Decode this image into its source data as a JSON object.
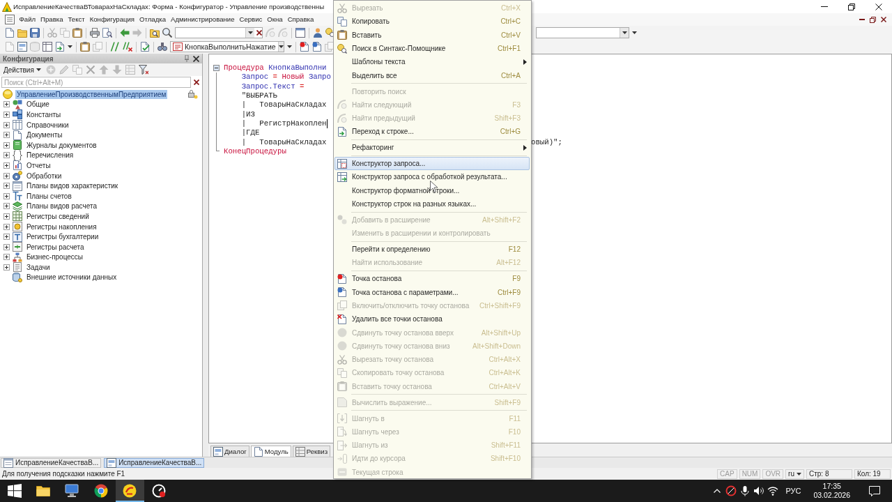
{
  "window": {
    "title": "ИсправлениеКачестваВТоварахНаСкладах: Форма - Конфигуратор - Управление производственны"
  },
  "menu_bar": [
    "Файл",
    "Правка",
    "Текст",
    "Конфигурация",
    "Отладка",
    "Администрирование",
    "Сервис",
    "Окна",
    "Справка"
  ],
  "toolbar": {
    "procedure_selector": "КнопкаВыполнитьНажатие"
  },
  "config_panel": {
    "title": "Конфигурация",
    "actions": "Действия",
    "search": {
      "placeholder": "Поиск (Ctrl+Alt+M)"
    },
    "tree": [
      {
        "label": "УправлениеПроизводственнымПредприятием",
        "kind": "root",
        "selected": true,
        "children": [
          {
            "label": "Общие",
            "kind": "group",
            "expanded": false,
            "selected": false
          },
          {
            "label": "Константы",
            "kind": "group",
            "expanded": false,
            "selected": false
          },
          {
            "label": "Справочники",
            "kind": "group",
            "expanded": false,
            "selected": false
          },
          {
            "label": "Документы",
            "kind": "group",
            "expanded": false,
            "selected": false
          },
          {
            "label": "Журналы документов",
            "kind": "group",
            "expanded": false,
            "selected": false
          },
          {
            "label": "Перечисления",
            "kind": "group",
            "expanded": false,
            "selected": false
          },
          {
            "label": "Отчеты",
            "kind": "group",
            "expanded": false,
            "selected": false
          },
          {
            "label": "Обработки",
            "kind": "group",
            "expanded": false,
            "selected": false
          },
          {
            "label": "Планы видов характеристик",
            "kind": "group",
            "expanded": false,
            "selected": false
          },
          {
            "label": "Планы счетов",
            "kind": "group",
            "expanded": false,
            "selected": false
          },
          {
            "label": "Планы видов расчета",
            "kind": "group",
            "expanded": false,
            "selected": false
          },
          {
            "label": "Регистры сведений",
            "kind": "group",
            "expanded": false,
            "selected": false
          },
          {
            "label": "Регистры накопления",
            "kind": "group",
            "expanded": false,
            "selected": false
          },
          {
            "label": "Регистры бухгалтерии",
            "kind": "group",
            "expanded": false,
            "selected": false
          },
          {
            "label": "Регистры расчета",
            "kind": "group",
            "expanded": false,
            "selected": false
          },
          {
            "label": "Бизнес-процессы",
            "kind": "group",
            "expanded": false,
            "selected": false
          },
          {
            "label": "Задачи",
            "kind": "group",
            "expanded": false,
            "selected": false
          },
          {
            "label": "Внешние источники данных",
            "kind": "leaf",
            "selected": false
          }
        ]
      }
    ]
  },
  "editor": {
    "code": {
      "expanded": true,
      "lines": [
        {
          "tokens": [
            {
              "text": "Процедура ",
              "kind": "keyword"
            },
            {
              "text": "КнопкаВыполни",
              "kind": "identifier"
            }
          ],
          "caret": false
        },
        {
          "tokens": [
            {
              "text": "    Запрос ",
              "kind": "identifier"
            },
            {
              "text": "= ",
              "kind": "operator"
            },
            {
              "text": "Новый ",
              "kind": "keyword"
            },
            {
              "text": "Запро",
              "kind": "identifier"
            }
          ],
          "caret": false
        },
        {
          "tokens": [
            {
              "text": "    Запрос.Текст ",
              "kind": "identifier"
            },
            {
              "text": "=",
              "kind": "operator"
            }
          ],
          "caret": false
        },
        {
          "tokens": [
            {
              "text": "    \"ВЫБРАТЬ",
              "kind": "string"
            }
          ],
          "caret": false
        },
        {
          "tokens": [
            {
              "text": "    |   ТоварыНаСкладах",
              "kind": "string"
            }
          ],
          "caret": false
        },
        {
          "tokens": [
            {
              "text": "    |ИЗ",
              "kind": "string"
            }
          ],
          "caret": false
        },
        {
          "tokens": [
            {
              "text": "    |   РегистрНакоплен",
              "kind": "string"
            }
          ],
          "caret": true
        },
        {
          "tokens": [
            {
              "text": "    |ГДЕ",
              "kind": "string"
            }
          ],
          "caret": false
        },
        {
          "tokens": [
            {
              "text": "    |   ТоварыНаСкладах",
              "kind": "string"
            }
          ],
          "tail": [
            {
              "text": "овый)\";",
              "kind": "string"
            }
          ],
          "caret": false
        },
        {
          "tokens": [
            {
              "text": "КонецПроцедуры",
              "kind": "keyword"
            }
          ],
          "caret": false
        }
      ]
    },
    "tabs": [
      {
        "label": "Диалог",
        "selected": false
      },
      {
        "label": "Модуль",
        "selected": true
      },
      {
        "label": "Реквиз",
        "selected": false
      }
    ]
  },
  "context_menu": {
    "groups": [
      [
        {
          "label": "Вырезать",
          "shortcut": "Ctrl+X",
          "disabled": true,
          "selected": false,
          "submenu": false
        },
        {
          "label": "Копировать",
          "shortcut": "Ctrl+C",
          "disabled": false,
          "selected": false,
          "submenu": false
        },
        {
          "label": "Вставить",
          "shortcut": "Ctrl+V",
          "disabled": false,
          "selected": false,
          "submenu": false
        },
        {
          "label": "Поиск в Синтакс-Помощнике",
          "shortcut": "Ctrl+F1",
          "disabled": false,
          "selected": false,
          "submenu": false
        },
        {
          "label": "Шаблоны текста",
          "disabled": false,
          "selected": false,
          "submenu": true
        },
        {
          "label": "Выделить все",
          "shortcut": "Ctrl+A",
          "disabled": false,
          "selected": false,
          "submenu": false
        }
      ],
      [
        {
          "label": "Повторить поиск",
          "disabled": true,
          "selected": false,
          "submenu": false
        },
        {
          "label": "Найти следующий",
          "shortcut": "F3",
          "disabled": true,
          "selected": false,
          "submenu": false
        },
        {
          "label": "Найти предыдущий",
          "shortcut": "Shift+F3",
          "disabled": true,
          "selected": false,
          "submenu": false
        },
        {
          "label": "Переход к строке...",
          "shortcut": "Ctrl+G",
          "disabled": false,
          "selected": false,
          "submenu": false
        }
      ],
      [
        {
          "label": "Рефакторинг",
          "disabled": false,
          "selected": false,
          "submenu": true
        }
      ],
      [
        {
          "label": "Конструктор запроса...",
          "disabled": false,
          "selected": true,
          "submenu": false
        },
        {
          "label": "Конструктор запроса с обработкой результата...",
          "disabled": false,
          "selected": false,
          "submenu": false
        },
        {
          "label": "Конструктор форматной строки...",
          "disabled": false,
          "selected": false,
          "submenu": false
        },
        {
          "label": "Конструктор строк на разных языках...",
          "disabled": false,
          "selected": false,
          "submenu": false
        }
      ],
      [
        {
          "label": "Добавить в расширение",
          "shortcut": "Alt+Shift+F2",
          "disabled": true,
          "selected": false,
          "submenu": false
        },
        {
          "label": "Изменить в расширении и контролировать",
          "disabled": true,
          "selected": false,
          "submenu": false
        }
      ],
      [
        {
          "label": "Перейти к определению",
          "shortcut": "F12",
          "disabled": false,
          "selected": false,
          "submenu": false
        },
        {
          "label": "Найти использование",
          "shortcut": "Alt+F12",
          "disabled": true,
          "selected": false,
          "submenu": false
        }
      ],
      [
        {
          "label": "Точка останова",
          "shortcut": "F9",
          "disabled": false,
          "selected": false,
          "submenu": false
        },
        {
          "label": "Точка останова с параметрами...",
          "shortcut": "Ctrl+F9",
          "disabled": false,
          "selected": false,
          "submenu": false
        },
        {
          "label": "Включить/отключить точку останова",
          "shortcut": "Ctrl+Shift+F9",
          "disabled": true,
          "selected": false,
          "submenu": false
        },
        {
          "label": "Удалить все точки останова",
          "disabled": false,
          "selected": false,
          "submenu": false
        },
        {
          "label": "Сдвинуть точку останова вверх",
          "shortcut": "Alt+Shift+Up",
          "disabled": true,
          "selected": false,
          "submenu": false
        },
        {
          "label": "Сдвинуть точку останова вниз",
          "shortcut": "Alt+Shift+Down",
          "disabled": true,
          "selected": false,
          "submenu": false
        },
        {
          "label": "Вырезать точку останова",
          "shortcut": "Ctrl+Alt+X",
          "disabled": true,
          "selected": false,
          "submenu": false
        },
        {
          "label": "Скопировать точку останова",
          "shortcut": "Ctrl+Alt+K",
          "disabled": true,
          "selected": false,
          "submenu": false
        },
        {
          "label": "Вставить точку останова",
          "shortcut": "Ctrl+Alt+V",
          "disabled": true,
          "selected": false,
          "submenu": false
        }
      ],
      [
        {
          "label": "Вычислить выражение...",
          "shortcut": "Shift+F9",
          "disabled": true,
          "selected": false,
          "submenu": false
        }
      ],
      [
        {
          "label": "Шагнуть в",
          "shortcut": "F11",
          "disabled": true,
          "selected": false,
          "submenu": false
        },
        {
          "label": "Шагнуть через",
          "shortcut": "F10",
          "disabled": true,
          "selected": false,
          "submenu": false
        },
        {
          "label": "Шагнуть из",
          "shortcut": "Shift+F11",
          "disabled": true,
          "selected": false,
          "submenu": false
        },
        {
          "label": "Идти до курсора",
          "shortcut": "Shift+F10",
          "disabled": true,
          "selected": false,
          "submenu": false
        },
        {
          "label": "Текущая строка",
          "disabled": true,
          "selected": false,
          "submenu": false
        }
      ]
    ]
  },
  "window_tabs": [
    {
      "label": "ИсправлениеКачестваВ...",
      "selected": false
    },
    {
      "label": "ИсправлениеКачестваВ...",
      "selected": true
    }
  ],
  "status_bar": {
    "hint": "Для получения подсказки нажмите F1",
    "indicators": [
      {
        "label": "CAP",
        "on": false
      },
      {
        "label": "NUM",
        "on": false
      },
      {
        "label": "OVR",
        "on": false
      }
    ],
    "language": "ru",
    "line": "Стр: 8",
    "column": "Кол: 19"
  },
  "taskbar": {
    "apps": [
      {
        "selected": false
      },
      {
        "selected": false
      },
      {
        "selected": false
      },
      {
        "selected": true
      },
      {
        "selected": false
      }
    ],
    "tray": {
      "language": "РУС",
      "time": "17:35",
      "date": "03.02.2026"
    }
  }
}
